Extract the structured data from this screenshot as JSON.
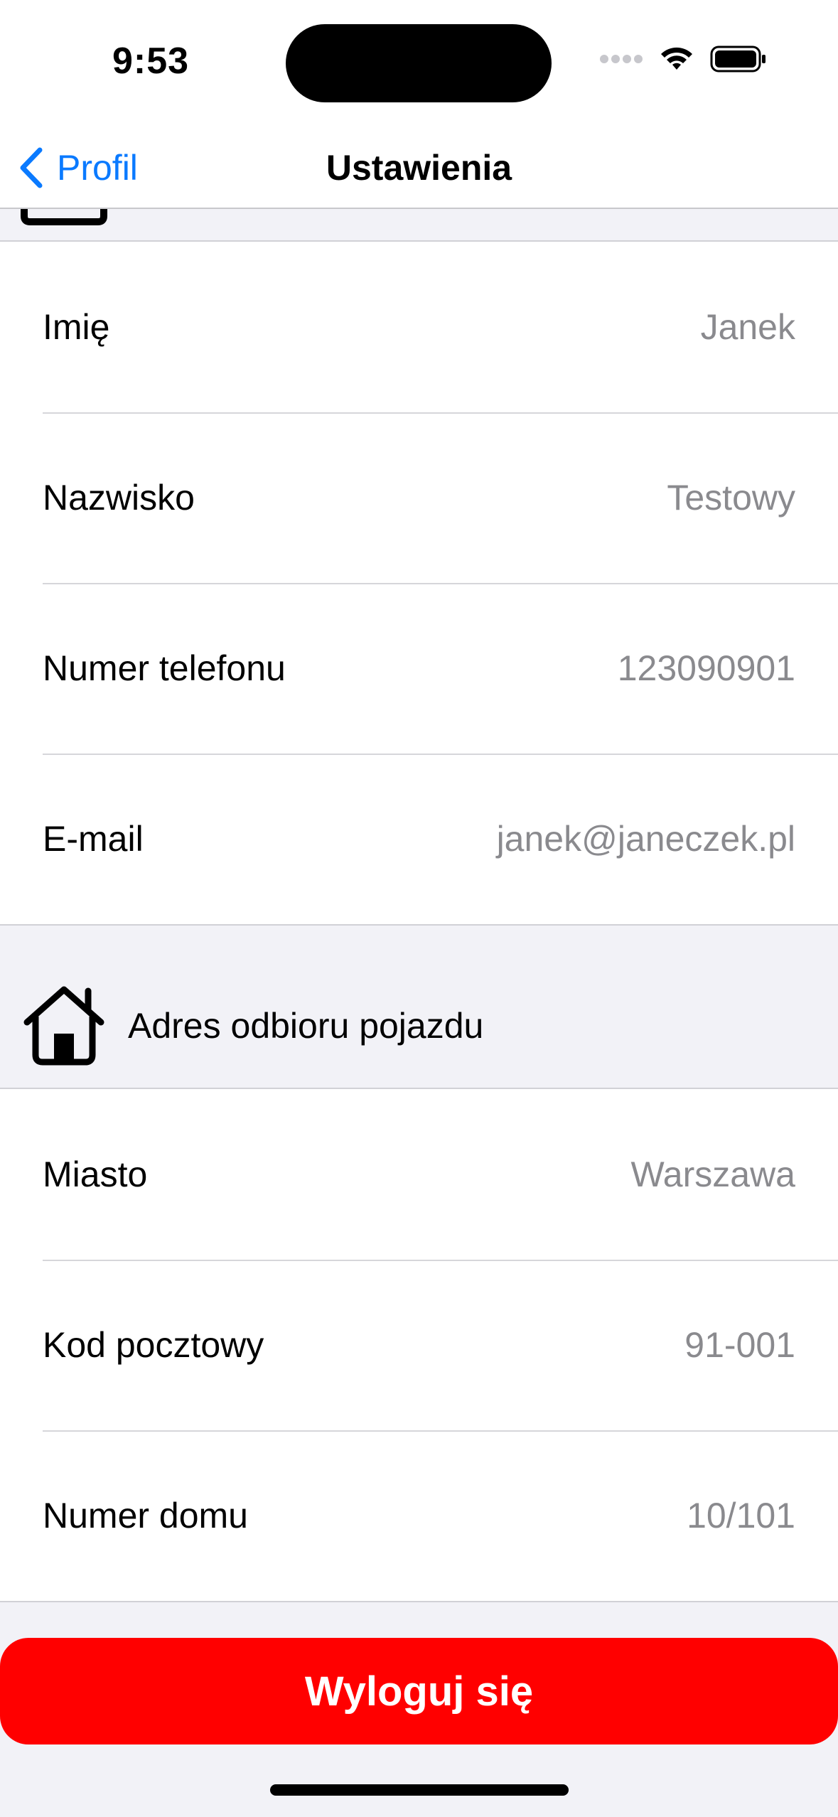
{
  "status_bar": {
    "time": "9:53"
  },
  "nav": {
    "back_label": "Profil",
    "title": "Ustawienia"
  },
  "personal_section": {
    "rows": [
      {
        "label": "Imię",
        "value": "Janek"
      },
      {
        "label": "Nazwisko",
        "value": "Testowy"
      },
      {
        "label": "Numer telefonu",
        "value": "123090901"
      },
      {
        "label": "E-mail",
        "value": "janek@janeczek.pl"
      }
    ]
  },
  "address_section": {
    "header": "Adres odbioru pojazdu",
    "rows": [
      {
        "label": "Miasto",
        "value": "Warszawa"
      },
      {
        "label": "Kod pocztowy",
        "value": "91-001"
      },
      {
        "label": "Numer domu",
        "value": "10/101"
      }
    ]
  },
  "logout": {
    "label": "Wyloguj się"
  },
  "colors": {
    "accent": "#0a7aff",
    "danger": "#ff0000",
    "background": "#f2f2f7",
    "value_text": "#8a8a8e"
  }
}
